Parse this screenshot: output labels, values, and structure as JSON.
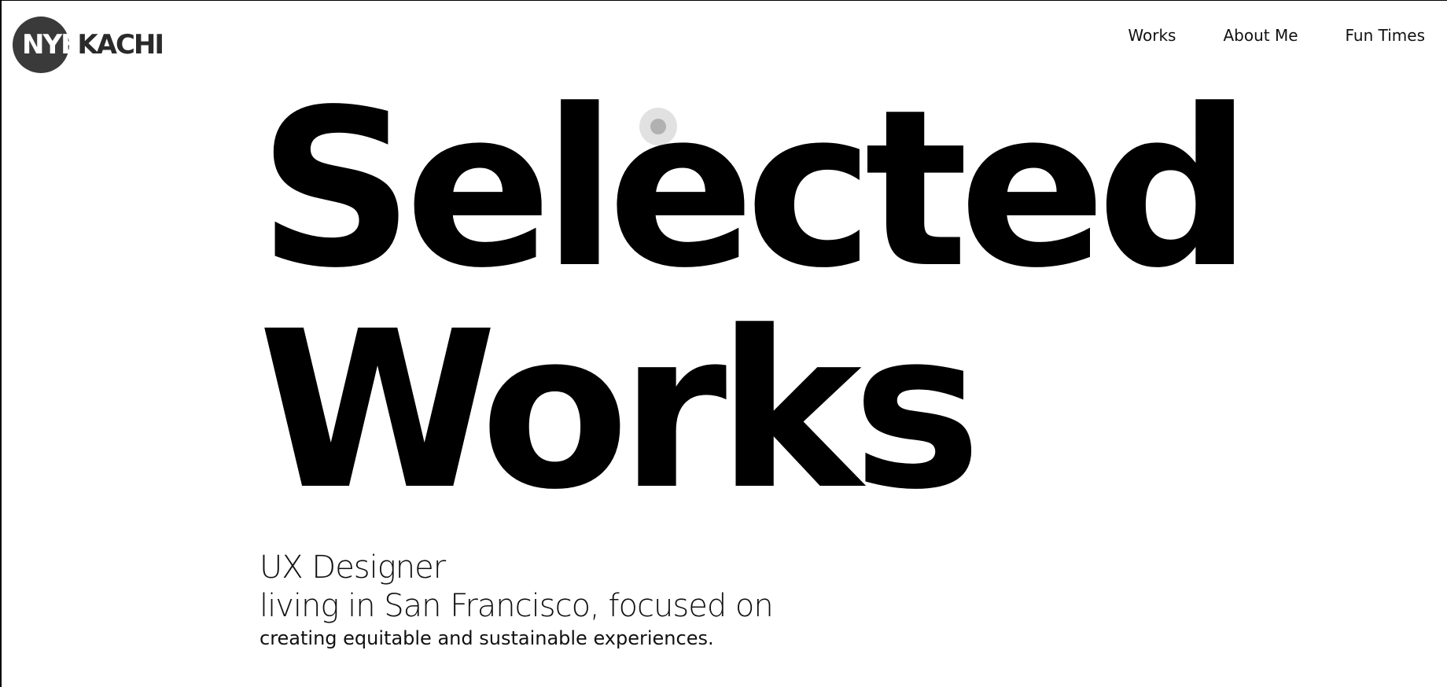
{
  "logo": {
    "text_light": "NYE",
    "text_dark": "KACHI",
    "circle_color": "#3a3a3a"
  },
  "nav": {
    "items": [
      {
        "label": "Works"
      },
      {
        "label": "About Me"
      },
      {
        "label": "Fun Times"
      }
    ]
  },
  "hero": {
    "line1": "Selected",
    "line2": "Works"
  },
  "intro": {
    "role": "UX Designer",
    "location": "living in San Francisco, focused on",
    "focus": "creating equitable and sustainable experiences."
  },
  "colors": {
    "text": "#000000",
    "background": "#ffffff",
    "cursor": "#c8c8c8"
  }
}
